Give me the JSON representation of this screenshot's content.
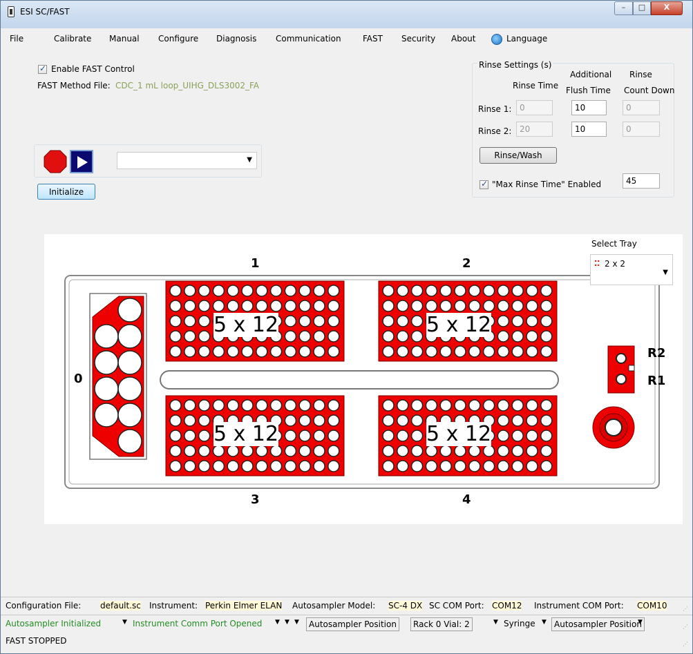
{
  "window": {
    "title": "ESI SC/FAST",
    "min": "–",
    "max": "□",
    "close": "X"
  },
  "menu": [
    "File",
    "Calibrate",
    "Manual",
    "Configure",
    "Diagnosis",
    "Communication",
    "FAST",
    "Security",
    "About",
    "Language"
  ],
  "fast": {
    "enable_label": "Enable FAST Control",
    "method_file_label": "FAST Method File:",
    "method_file_value": "CDC_1 mL loop_UIHG_DLS3002_FA",
    "initialize_label": "Initialize",
    "method_select_value": ""
  },
  "rinse": {
    "group_title": "Rinse Settings (s)",
    "col1": "Rinse Time",
    "col2a": "Additional",
    "col2b": "Flush Time",
    "col3a": "Rinse",
    "col3b": "Count Down",
    "row1_label": "Rinse 1:",
    "row1_time": "0",
    "row1_flush": "10",
    "row1_count": "0",
    "row2_label": "Rinse 2:",
    "row2_time": "20",
    "row2_flush": "10",
    "row2_count": "0",
    "wash_label": "Rinse/Wash",
    "max_label": "\"Max Rinse Time\" Enabled",
    "max_value": "45"
  },
  "tray": {
    "select_label": "Select Tray",
    "select_value": "2 x 2",
    "rack_labels": [
      "1",
      "2",
      "3",
      "4"
    ],
    "rack_text": "5 x 12",
    "rack0_label": "0",
    "r1": "R1",
    "r2": "R2"
  },
  "status1": {
    "config_label": "Configuration File:",
    "config_value": "default.sc",
    "instr_label": "Instrument:",
    "instr_value": "Perkin Elmer ELAN",
    "model_label": "Autosampler Model:",
    "model_value": "SC-4 DX",
    "sc_port_label": "SC COM Port:",
    "sc_port_value": "COM12",
    "instr_port_label": "Instrument COM Port:",
    "instr_port_value": "COM10"
  },
  "status2": {
    "init": "Autosampler Initialized",
    "comm": "Instrument Comm Port Opened",
    "pos1": "Autosampler Position",
    "rack": "Rack 0 Vial: 2",
    "syringe": "Syringe",
    "pos2": "Autosampler Position"
  },
  "status3": {
    "fast_state": "FAST  STOPPED"
  },
  "colors": {
    "rack_red": "#ee0000",
    "status_green": "#238c23",
    "highlight": "#fff9d8"
  }
}
